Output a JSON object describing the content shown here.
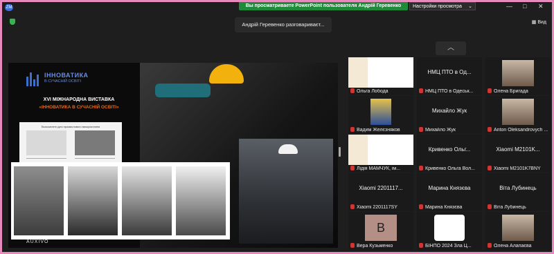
{
  "topbar": {
    "logo_label": "ZM",
    "share_banner": "Вы просматриваете PowerPoint пользователя Андрій Геревенко",
    "view_options": "Настройки просмотра",
    "minimize": "—",
    "maximize": "□",
    "close": "✕",
    "view_label": "Вид",
    "speaking": "Андрій Геревенко разговариваєт..."
  },
  "slide": {
    "logo_title": "ІННОВАТИКА",
    "logo_subtitle": "В СУЧАСНІЙ ОСВІТІ",
    "exhibition": "XVI МІЖНАРОДНА ВИСТАВКА",
    "exhibition_name": "«ІННОВАТИКА В СУЧАСНІЙ ОСВІТІ»",
    "brochure_heading": "Екзоскелети для промислового використання",
    "brand": "AUXIVO",
    "colors": {
      "accent_orange": "#e86a18",
      "brand_blue": "#3b6fd0",
      "helmet_yellow": "#f2b10d"
    }
  },
  "gallery": {
    "participants": [
      {
        "big_label": "",
        "name": "Ольга Лобода",
        "thumb": "logo-institute"
      },
      {
        "big_label": "НМЦ ПТО в Од...",
        "name": "НМЦ ПТО в Одеськ...",
        "thumb": ""
      },
      {
        "big_label": "",
        "name": "Олена Бригада",
        "thumb": "photo"
      },
      {
        "big_label": "",
        "name": "Вадим Желєзняков",
        "thumb": "emblem"
      },
      {
        "big_label": "Михайло Жук",
        "name": "Михайло Жук",
        "thumb": ""
      },
      {
        "big_label": "",
        "name": "Anton Oleksandrovych ...",
        "thumb": "photo"
      },
      {
        "big_label": "",
        "name": "Лідія МАМЧУК, ім...",
        "thumb": "logo-institute"
      },
      {
        "big_label": "Кривенко Ольг...",
        "name": "Кривенко Ольга Вол...",
        "thumb": ""
      },
      {
        "big_label": "Xiaomi M2101K...",
        "name": "Xiaomi M2101K7BNY",
        "thumb": ""
      },
      {
        "big_label": "Xiaomi 2201117...",
        "name": "Xiaomi 2201117SY",
        "thumb": ""
      },
      {
        "big_label": "Марина Князєва",
        "name": "Марина Князєва",
        "thumb": ""
      },
      {
        "big_label": "Віта Лубинець",
        "name": "Віта Лубинець",
        "thumb": ""
      },
      {
        "big_label": "",
        "name": "Вера Кузьменко",
        "thumb": "avatar-letter",
        "avatar_letter": "B"
      },
      {
        "big_label": "",
        "name": "БІНПО 2024 Зла Ц...",
        "thumb": "logo-round"
      },
      {
        "big_label": "",
        "name": "Олена Алапаєва",
        "thumb": "photo"
      }
    ]
  }
}
